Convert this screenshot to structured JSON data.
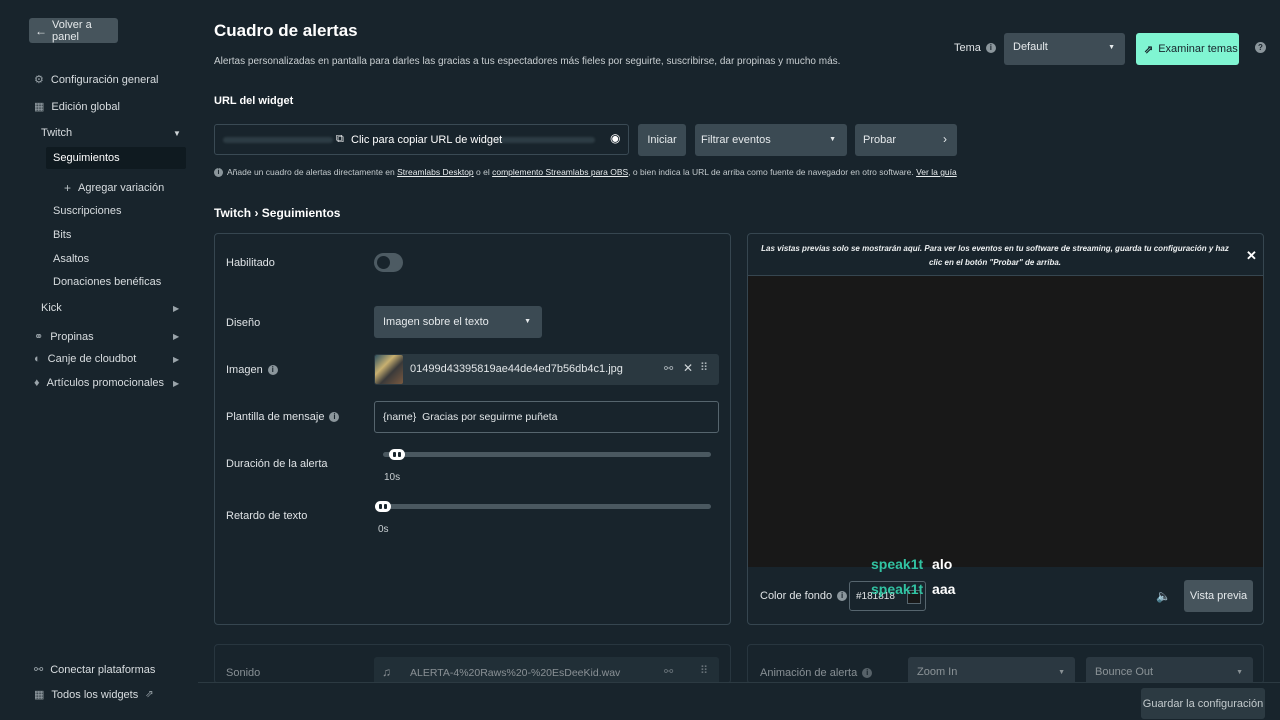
{
  "sidebar": {
    "back": "Volver a panel",
    "general": "Configuración general",
    "global": "Edición global",
    "twitch": "Twitch",
    "seguimientos": "Seguimientos",
    "agregar": "Agregar variación",
    "suscripciones": "Suscripciones",
    "bits": "Bits",
    "asaltos": "Asaltos",
    "donaciones": "Donaciones benéficas",
    "kick": "Kick",
    "propinas": "Propinas",
    "canje": "Canje de cloudbot",
    "articulos": "Artículos promocionales",
    "conectar": "Conectar plataformas",
    "widgets": "Todos los widgets"
  },
  "header": {
    "title": "Cuadro de alertas",
    "subtitle": "Alertas personalizadas en pantalla para darles las gracias a tus espectadores más fieles por seguirte, suscribirse, dar propinas y mucho más.",
    "tema_label": "Tema",
    "tema_value": "Default",
    "examinar": "Examinar temas"
  },
  "widget": {
    "url_label": "URL del widget",
    "copy": "Clic para copiar URL de widget",
    "iniciar": "Iniciar",
    "filtrar": "Filtrar eventos",
    "probar": "Probar",
    "hint_pre": "Añade un cuadro de alertas directamente en ",
    "hint_link1": "Streamlabs Desktop",
    "hint_mid": " o el ",
    "hint_link2": "complemento Streamlabs para OBS",
    "hint_post": ", o bien indica la URL de arriba como fuente de navegador en otro software. ",
    "hint_link3": "Ver la guía"
  },
  "breadcrumb": {
    "a": "Twitch",
    "sep": "›",
    "b": "Seguimientos"
  },
  "form": {
    "habilitado": "Habilitado",
    "diseno": "Diseño",
    "diseno_value": "Imagen sobre el texto",
    "imagen": "Imagen",
    "imagen_file": "01499d43395819ae44de4ed7b56db4c1.jpg",
    "plantilla": "Plantilla de mensaje",
    "plantilla_value": "{name}  Gracias por seguirme puñeta",
    "duracion": "Duración de la alerta",
    "duracion_value": "10s",
    "duracion_level": 0.02,
    "retardo": "Retardo de texto",
    "retardo_value": "0s",
    "retardo_level": 0,
    "sonido": "Sonido",
    "sonido_file": "ALERTA-4%20Raws%20-%20EsDeeKid.wav"
  },
  "preview": {
    "notice": "Las vistas previas solo se mostrarán aquí. Para ver los eventos en tu software de streaming, guarda tu configuración y haz clic en el botón \"Probar\" de arriba.",
    "color_label": "Color de fondo",
    "color_value": "#181818",
    "vista": "Vista previa",
    "anim_label": "Animación de alerta",
    "anim_in": "Zoom In",
    "anim_out": "Bounce Out"
  },
  "chat": [
    {
      "user": "speak1t",
      "msg": "alo"
    },
    {
      "user": "speak1t",
      "msg": "aaa"
    }
  ],
  "footer": {
    "save": "Guardar la configuración"
  },
  "colors": {
    "accent": "#80f5d2",
    "bg": "#18242c",
    "chat_user": "#31c3a2"
  }
}
